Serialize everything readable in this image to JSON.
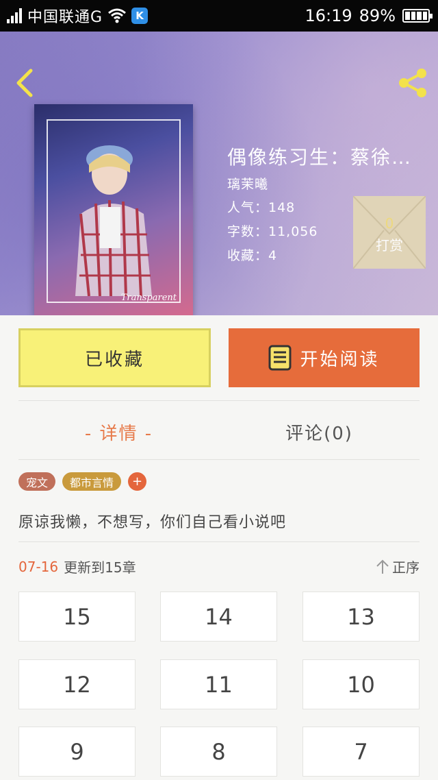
{
  "status_bar": {
    "carrier": "中国联通G",
    "app_badge": "K",
    "time": "16:19",
    "battery": "89%",
    "icons": [
      "signal-icon",
      "wifi-icon",
      "battery-icon"
    ]
  },
  "header": {
    "back_icon": "chevron-left-icon",
    "share_icon": "share-icon"
  },
  "book": {
    "title": "偶像练习生：蔡徐…",
    "author": "璃茉曦",
    "popularity": "人气：148",
    "word_count": "字数：11,056",
    "favorites": "收藏：4",
    "cover_signature": "Transparent"
  },
  "reward": {
    "count": "0",
    "label": "打赏"
  },
  "actions": {
    "collected_label": "已收藏",
    "read_label": "开始阅读"
  },
  "tabs": {
    "detail": "- 详情 -",
    "comments": "评论(0)"
  },
  "tags": [
    {
      "label": "宠文",
      "color": "#c0705a"
    },
    {
      "label": "都市言情",
      "color": "#c99a3c"
    },
    {
      "label": "+",
      "color": "#e4663c"
    }
  ],
  "description": "原谅我懒，不想写，你们自己看小说吧",
  "update": {
    "date": "07-16",
    "text": "更新到15章",
    "sort_label": "正序",
    "sort_icon": "arrow-up-icon"
  },
  "chapters": [
    "15",
    "14",
    "13",
    "12",
    "11",
    "10",
    "9",
    "8",
    "7"
  ],
  "colors": {
    "accent": "#e66c3b",
    "collected_bg": "#f8f178",
    "tab_active": "#e77a4a"
  }
}
